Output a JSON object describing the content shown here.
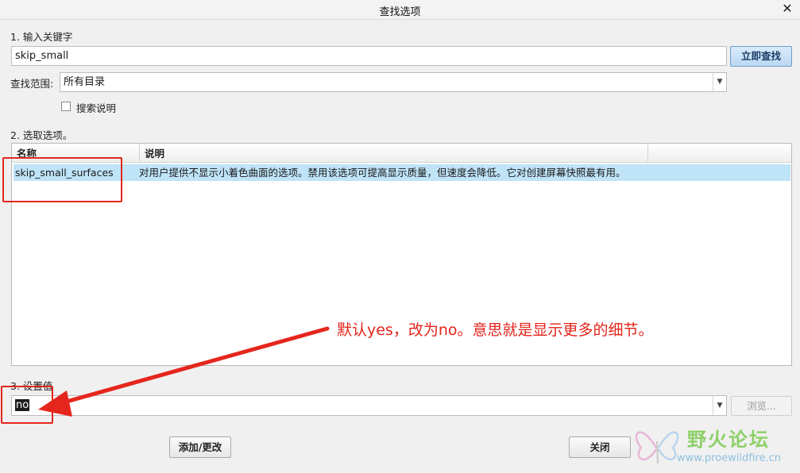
{
  "window": {
    "title": "查找选项",
    "close_glyph": "✕"
  },
  "step1": {
    "label": "1. 输入关键字",
    "keyword_value": "skip_small",
    "search_button": "立即查找"
  },
  "scope": {
    "label": "查找范围:",
    "selected": "所有目录"
  },
  "search_desc": {
    "label": "搜索说明",
    "checked": false
  },
  "step2": {
    "label": "2. 选取选项。"
  },
  "table": {
    "columns": [
      "名称",
      "说明"
    ],
    "rows": [
      {
        "name": "skip_small_surfaces",
        "description": "对用户提供不显示小着色曲面的选项。禁用该选项可提高显示质量，但速度会降低。它对创建屏幕快照最有用。",
        "selected": true
      }
    ]
  },
  "step3": {
    "label": "3. 设置值",
    "value": "no",
    "browse_button": "浏览..."
  },
  "footer": {
    "add_change_button": "添加/更改",
    "close_button": "关闭"
  },
  "annotation": {
    "text": "默认yes，改为no。意思就是显示更多的细节。",
    "color": "#e2231a"
  },
  "watermark": {
    "title": "野火论坛",
    "url": "www.proewildfire.cn"
  },
  "colors": {
    "selection": "#bfe3f7",
    "primary_button": "#bcd8f3",
    "annotation_red": "#e5261d"
  }
}
